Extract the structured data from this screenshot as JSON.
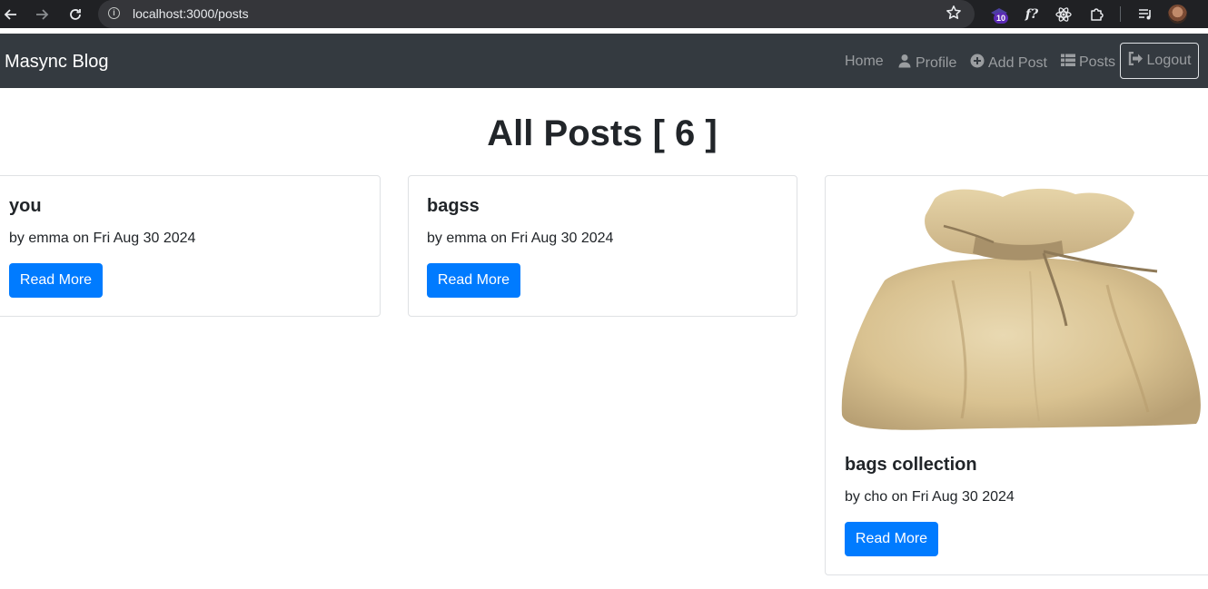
{
  "browser": {
    "url": "localhost:3000/posts",
    "extension_badge": "10"
  },
  "navbar": {
    "brand": "Masync Blog",
    "links": {
      "home": "Home",
      "profile": "Profile",
      "add_post": "Add Post",
      "posts": "Posts"
    },
    "logout": "Logout"
  },
  "page": {
    "heading": "All Posts [ 6 ]"
  },
  "posts": [
    {
      "title": "you",
      "meta": "by emma on Fri Aug 30 2024",
      "button": "Read More"
    },
    {
      "title": "bagss",
      "meta": "by emma on Fri Aug 30 2024",
      "button": "Read More"
    },
    {
      "title": "bags collection",
      "meta": "by cho on Fri Aug 30 2024",
      "button": "Read More",
      "image": "burlap-sack-image"
    }
  ],
  "colors": {
    "navbar_bg": "#343a40",
    "primary": "#007bff",
    "chrome_bg": "#202124"
  }
}
